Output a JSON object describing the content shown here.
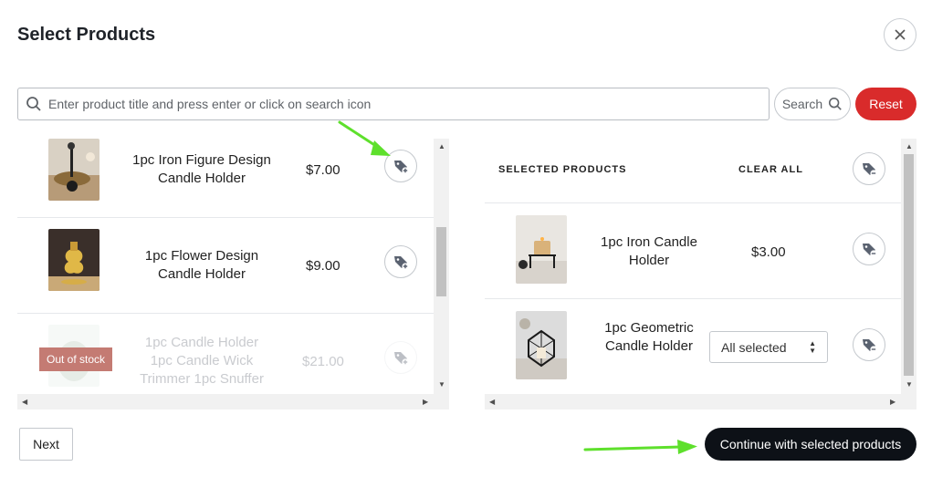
{
  "modal": {
    "title": "Select Products"
  },
  "search": {
    "placeholder": "Enter product title and press enter or click on search icon",
    "value": "",
    "search_label": "Search",
    "reset_label": "Reset"
  },
  "products": [
    {
      "name": "1pc Iron Figure Design Candle Holder",
      "price": "$7.00",
      "out_of_stock": false
    },
    {
      "name": "1pc Flower Design Candle Holder",
      "price": "$9.00",
      "out_of_stock": false
    },
    {
      "name": "1pc Candle Holder 1pc Candle Wick Trimmer 1pc Snuffer",
      "price": "$21.00",
      "out_of_stock": true,
      "badge": "Out of stock"
    }
  ],
  "selected": {
    "header_label": "SELECTED PRODUCTS",
    "clear_all_label": "CLEAR ALL",
    "items": [
      {
        "name": "1pc Iron Candle Holder",
        "price": "$3.00"
      },
      {
        "name": "1pc Geometric Candle Holder",
        "variant": "All selected"
      }
    ]
  },
  "footer": {
    "next_label": "Next",
    "continue_label": "Continue with selected products"
  },
  "colors": {
    "reset": "#d92b2b",
    "continue": "#0d1117",
    "out_of_stock_badge": "#c47b73",
    "annotation_arrow": "#5ee02c"
  },
  "icons": {
    "close": "close-icon",
    "search": "search-icon",
    "add": "tag-plus-icon",
    "remove": "tag-minus-icon"
  }
}
